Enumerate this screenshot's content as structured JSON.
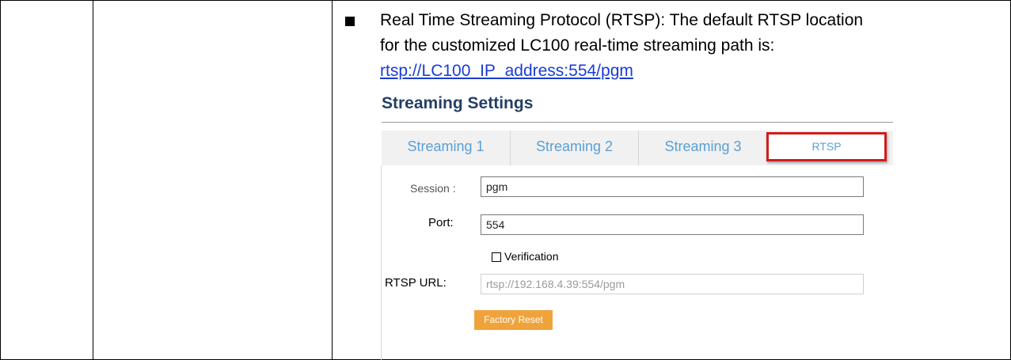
{
  "content": {
    "bullet_text_line1": "Real Time Streaming Protocol (RTSP): The default RTSP location",
    "bullet_text_line2": "for the customized LC100 real-time streaming path is:",
    "rtsp_link": "rtsp://LC100_IP_address:554/pgm"
  },
  "settings": {
    "title": "Streaming Settings",
    "tabs": [
      {
        "label": "Streaming 1"
      },
      {
        "label": "Streaming 2"
      },
      {
        "label": "Streaming 3"
      },
      {
        "label": "RTSP",
        "selected": true
      }
    ],
    "session": {
      "label": "Session :",
      "value": "pgm"
    },
    "port": {
      "label": "Port:",
      "value": "554"
    },
    "verification": {
      "label": "Verification",
      "checked": false
    },
    "rtsp_url": {
      "label": "RTSP URL:",
      "value": "rtsp://192.168.4.39:554/pgm"
    },
    "factory_reset_label": "Factory Reset"
  },
  "colors": {
    "tab_text": "#5aa0d6",
    "highlight_border": "#d11d1d",
    "title": "#243f66",
    "button": "#f0a33b",
    "link": "#1a3cd6"
  }
}
